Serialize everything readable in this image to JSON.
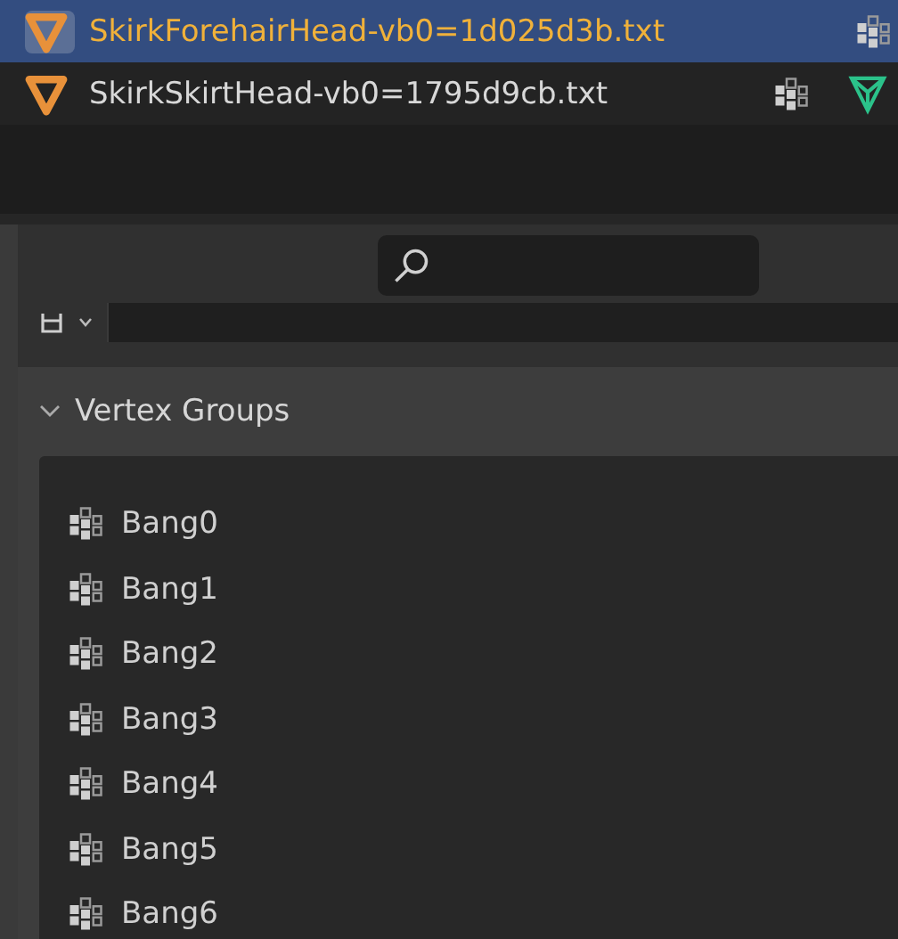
{
  "outliner": {
    "rows": [
      {
        "name": "SkirkForehairHead-vb0=1d025d3b.txt",
        "selected": true,
        "has_mesh_icon": false
      },
      {
        "name": "SkirkSkirtHead-vb0=1795d9cb.txt",
        "selected": false,
        "has_mesh_icon": true
      }
    ]
  },
  "properties": {
    "panel": {
      "title": "Vertex Groups",
      "expanded": true
    },
    "vertex_groups": [
      "Bang0",
      "Bang1",
      "Bang2",
      "Bang3",
      "Bang4",
      "Bang5",
      "Bang6"
    ]
  }
}
